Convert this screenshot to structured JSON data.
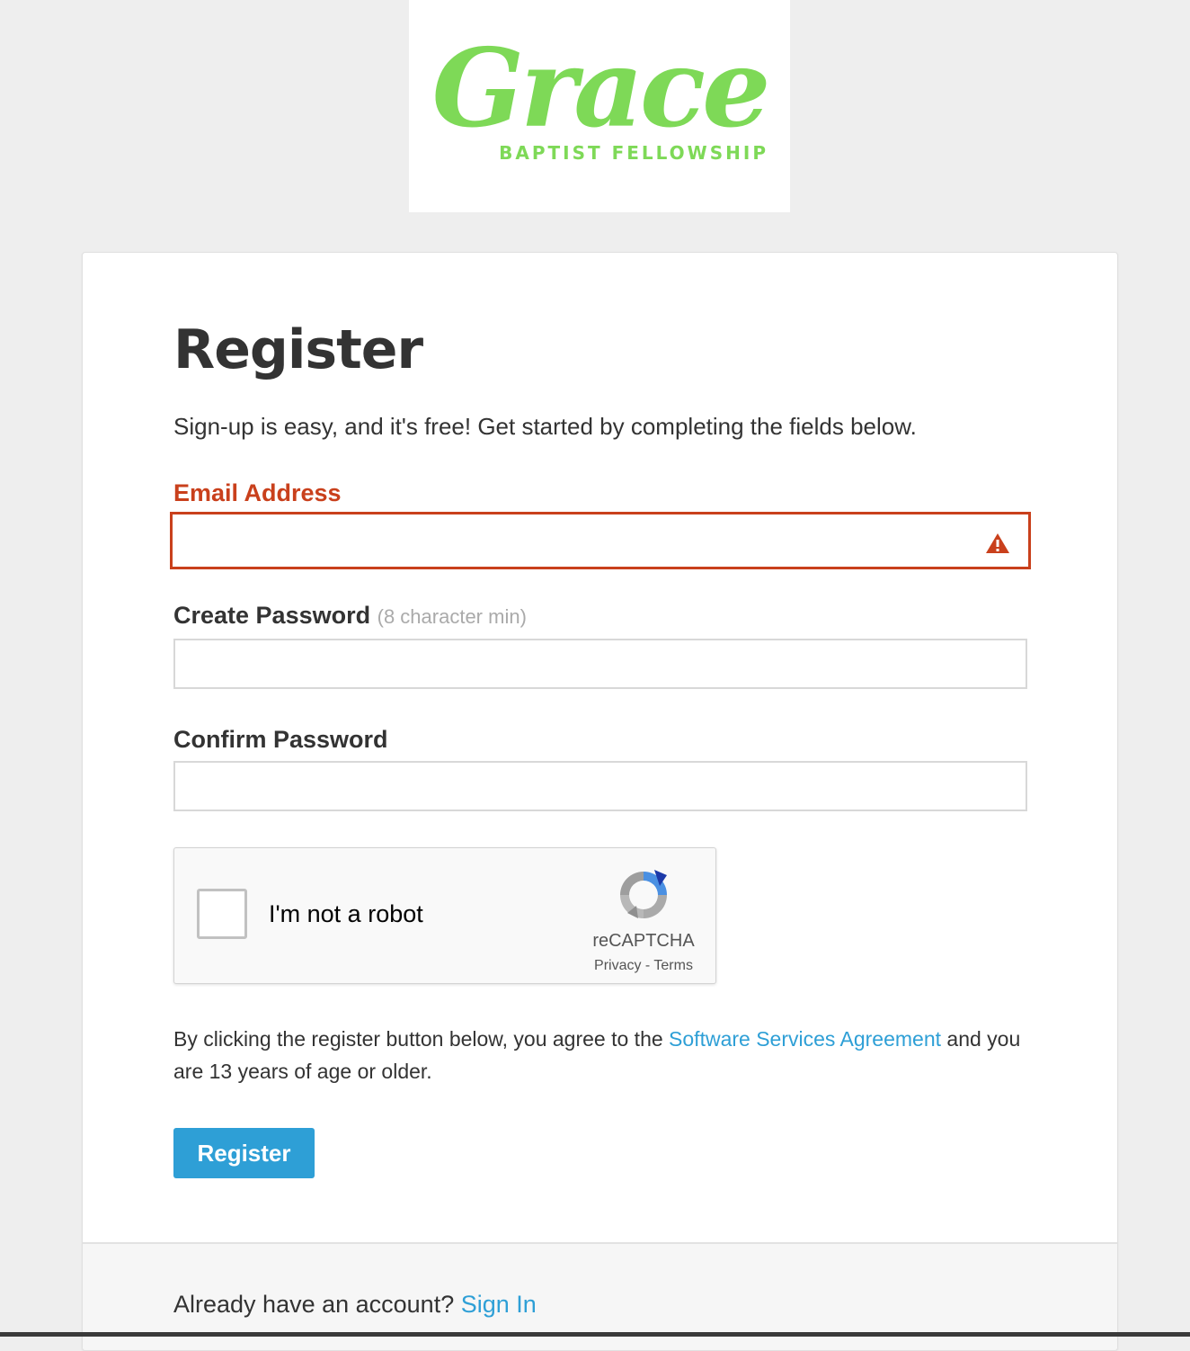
{
  "logo": {
    "main_text": "Grace",
    "sub_text": "BAPTIST FELLOWSHIP",
    "color": "#7ed957"
  },
  "page": {
    "title": "Register",
    "intro": "Sign-up is easy, and it's free! Get started by completing the fields below."
  },
  "form": {
    "email": {
      "label": "Email Address",
      "value": "",
      "error_icon": "warning-triangle-icon"
    },
    "password": {
      "label": "Create Password",
      "hint": "(8 character min)",
      "value": ""
    },
    "confirm_password": {
      "label": "Confirm Password",
      "value": ""
    }
  },
  "recaptcha": {
    "label": "I'm not a robot",
    "brand": "reCAPTCHA",
    "privacy": "Privacy",
    "separator": " - ",
    "terms": "Terms"
  },
  "agreement": {
    "prefix": "By clicking the register button below, you agree to the ",
    "link": "Software Services Agreement",
    "suffix": " and you are 13 years of age or older."
  },
  "register_button": "Register",
  "footer": {
    "question": "Already have an account? ",
    "link": "Sign In"
  },
  "colors": {
    "accent": "#2e9fd6",
    "error": "#c9401c",
    "logo_green": "#7ed957"
  }
}
